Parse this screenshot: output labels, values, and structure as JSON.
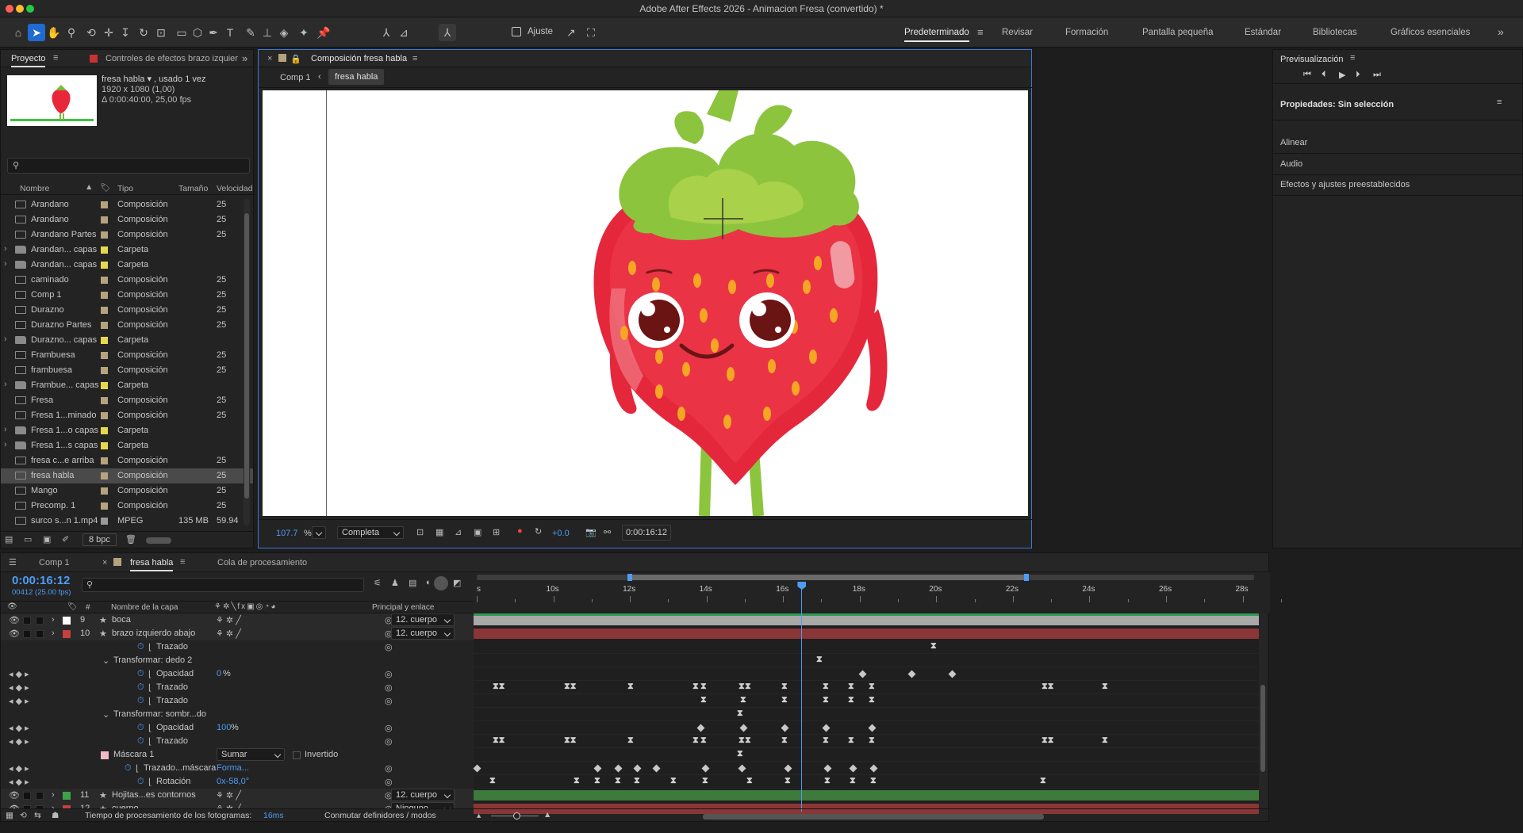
{
  "app": {
    "title": "Adobe After Effects 2026 - Animacion Fresa (convertido) *"
  },
  "toolbar": {
    "snap_label": "Ajuste"
  },
  "workspaces": [
    "Predeterminado",
    "Revisar",
    "Formación",
    "Pantalla pequeña",
    "Estándar",
    "Bibliotecas",
    "Gráficos esenciales"
  ],
  "project_panel": {
    "tab_project": "Proyecto",
    "tab_effects": "Controles de efectos brazo izquier",
    "item_name": "fresa habla ▾ , usado 1 vez",
    "item_dims": "1920 x 1080 (1,00)",
    "item_duration": "Δ 0:00:40:00, 25,00 fps",
    "columns": {
      "name": "Nombre",
      "type": "Tipo",
      "size": "Tamaño",
      "speed": "Velocidad"
    },
    "bpc": "8 bpc",
    "items": [
      {
        "name": "Arandano",
        "type": "Composición",
        "size": "",
        "fps": "25",
        "kind": "comp",
        "color": "#b5a27e"
      },
      {
        "name": "Arandano",
        "type": "Composición",
        "size": "",
        "fps": "25",
        "kind": "comp",
        "color": "#b5a27e"
      },
      {
        "name": "Arandano Partes",
        "type": "Composición",
        "size": "",
        "fps": "25",
        "kind": "comp",
        "color": "#b5a27e"
      },
      {
        "name": "Arandan... capas",
        "type": "Carpeta",
        "size": "",
        "fps": "",
        "kind": "folder",
        "color": "#e6d84c"
      },
      {
        "name": "Arandan... capas",
        "type": "Carpeta",
        "size": "",
        "fps": "",
        "kind": "folder",
        "color": "#e6d84c"
      },
      {
        "name": "caminado",
        "type": "Composición",
        "size": "",
        "fps": "25",
        "kind": "comp",
        "color": "#b5a27e"
      },
      {
        "name": "Comp 1",
        "type": "Composición",
        "size": "",
        "fps": "25",
        "kind": "comp",
        "color": "#b5a27e"
      },
      {
        "name": "Durazno",
        "type": "Composición",
        "size": "",
        "fps": "25",
        "kind": "comp",
        "color": "#b5a27e"
      },
      {
        "name": "Durazno Partes",
        "type": "Composición",
        "size": "",
        "fps": "25",
        "kind": "comp",
        "color": "#b5a27e"
      },
      {
        "name": "Durazno... capas",
        "type": "Carpeta",
        "size": "",
        "fps": "",
        "kind": "folder",
        "color": "#e6d84c"
      },
      {
        "name": "Frambuesa",
        "type": "Composición",
        "size": "",
        "fps": "25",
        "kind": "comp",
        "color": "#b5a27e"
      },
      {
        "name": "frambuesa",
        "type": "Composición",
        "size": "",
        "fps": "25",
        "kind": "comp",
        "color": "#b5a27e"
      },
      {
        "name": "Frambue... capas",
        "type": "Carpeta",
        "size": "",
        "fps": "",
        "kind": "folder",
        "color": "#e6d84c"
      },
      {
        "name": "Fresa",
        "type": "Composición",
        "size": "",
        "fps": "25",
        "kind": "comp",
        "color": "#b5a27e"
      },
      {
        "name": "Fresa 1...minado",
        "type": "Composición",
        "size": "",
        "fps": "25",
        "kind": "comp",
        "color": "#b5a27e"
      },
      {
        "name": "Fresa 1...o capas",
        "type": "Carpeta",
        "size": "",
        "fps": "",
        "kind": "folder",
        "color": "#e6d84c"
      },
      {
        "name": "Fresa 1...s capas",
        "type": "Carpeta",
        "size": "",
        "fps": "",
        "kind": "folder",
        "color": "#e6d84c"
      },
      {
        "name": "fresa c...e arriba",
        "type": "Composición",
        "size": "",
        "fps": "25",
        "kind": "comp",
        "color": "#b5a27e"
      },
      {
        "name": "fresa habla",
        "type": "Composición",
        "size": "",
        "fps": "25",
        "kind": "comp",
        "color": "#b5a27e",
        "selected": true
      },
      {
        "name": "Mango",
        "type": "Composición",
        "size": "",
        "fps": "25",
        "kind": "comp",
        "color": "#b5a27e"
      },
      {
        "name": "Precomp. 1",
        "type": "Composición",
        "size": "",
        "fps": "25",
        "kind": "comp",
        "color": "#b5a27e"
      },
      {
        "name": "surco s...n 1.mp4",
        "type": "MPEG",
        "size": "135 MB",
        "fps": "59.94",
        "kind": "file",
        "color": "#9a9a9a"
      }
    ]
  },
  "comp_panel": {
    "tab_title": "Composición fresa habla",
    "breadcrumb_1": "Comp 1",
    "breadcrumb_2": "fresa habla",
    "zoom": "107.7",
    "zoom_unit": "%",
    "resolution": "Completa",
    "exposure": "+0.0",
    "timecode": "0:00:16:12"
  },
  "preview_panel": {
    "title": "Previsualización"
  },
  "properties_panel": {
    "title": "Propiedades: Sin selección",
    "sections": [
      "Alinear",
      "Audio",
      "Efectos y ajustes preestablecidos"
    ]
  },
  "timeline": {
    "tab_comp1": "Comp 1",
    "tab_fresa": "fresa habla",
    "tab_queue": "Cola de procesamiento",
    "timecode": "0:00:16:12",
    "frames": "00412 (25.00 fps)",
    "col_layer_name": "Nombre de la capa",
    "col_parent": "Principal y enlace",
    "ruler": {
      "labels": [
        "s",
        "10s",
        "12s",
        "14s",
        "16s",
        "18s",
        "20s",
        "22s",
        "24s",
        "26s",
        "28s"
      ],
      "start": 8,
      "end": 28.3,
      "playhead": 16.48
    },
    "layers": [
      {
        "num": "9",
        "name": "boca",
        "parent": "12. cuerpo",
        "color": "#ffffff",
        "bar": "#a9a9a9"
      },
      {
        "num": "10",
        "name": "brazo izquierdo abajo",
        "parent": "12. cuerpo",
        "color": "#c64040",
        "bar": "#8b3636"
      }
    ],
    "props": {
      "trazado": "Trazado",
      "transform_dedo": "Transformar: dedo 2",
      "opacidad": "Opacidad",
      "opacidad_val1": "0",
      "transform_sombra": "Transformar: sombr...do",
      "opacidad_val2": "100",
      "percent": "%",
      "mascara": "Máscara 1",
      "mask_mode": "Sumar",
      "invertido": "Invertido",
      "trazado_mascara": "Trazado...máscara",
      "trazado_mascara_val": "Forma...",
      "rotacion": "Rotación",
      "rotacion_val": "0x-58,0°"
    },
    "layers_bottom": [
      {
        "num": "11",
        "name": "Hojitas...es contornos",
        "parent": "12. cuerpo",
        "color": "#3da34a",
        "bar": "#3e7a3b"
      },
      {
        "num": "12",
        "name": "cuerpo",
        "parent": "Ninguno",
        "color": "#c64040",
        "bar": "#8b3636"
      }
    ]
  },
  "status": {
    "render_label": "Tiempo de procesamiento de los fotogramas:",
    "render_value": "16ms",
    "toggle_label": "Conmutar definidores / modos"
  }
}
